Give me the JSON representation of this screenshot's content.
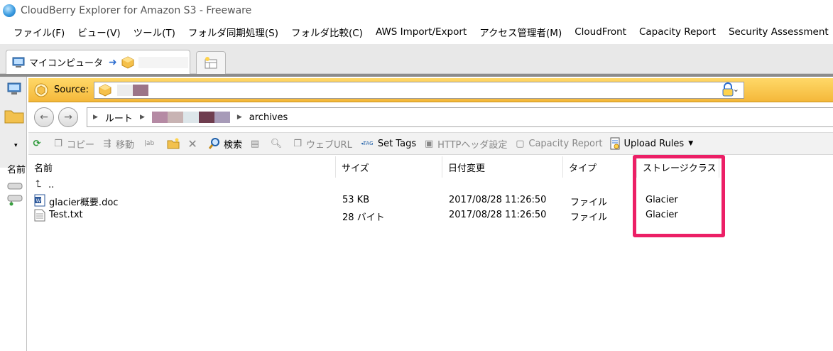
{
  "window": {
    "title": "CloudBerry Explorer for Amazon S3 - Freeware"
  },
  "menu": [
    "ファイル(F)",
    "ビュー(V)",
    "ツール(T)",
    "フォルダ同期処理(S)",
    "フォルダ比較(C)",
    "AWS Import/Export",
    "アクセス管理者(M)",
    "CloudFront",
    "Capacity Report",
    "Security Assessment"
  ],
  "tabs": {
    "active_label": "マイコンピュータ",
    "arrow": "➜"
  },
  "source": {
    "label": "Source:"
  },
  "breadcrumb": {
    "root": "ルート",
    "last": "archives"
  },
  "toolbar": {
    "copy": "コピー",
    "move": "移動",
    "search": "検索",
    "web_url": "ウェブURL",
    "set_tags": "Set Tags",
    "http_headers": "HTTPヘッダ設定",
    "capacity_report": "Capacity Report",
    "upload_rules": "Upload Rules"
  },
  "left_pane": {
    "header": "名前"
  },
  "file_list": {
    "columns": {
      "name": "名前",
      "size": "サイズ",
      "modified": "日付変更",
      "type": "タイプ",
      "storage_class": "ストレージクラス"
    },
    "parent": "..",
    "rows": [
      {
        "name": "glacier概要.doc",
        "size": "53 KB",
        "modified": "2017/08/28 11:26:50",
        "type": "ファイル",
        "storage_class": "Glacier"
      },
      {
        "name": "Test.txt",
        "size": "28 バイト",
        "modified": "2017/08/28 11:26:50",
        "type": "ファイル",
        "storage_class": "Glacier"
      }
    ]
  },
  "colors": {
    "highlight": "#ec1f66",
    "source_bar": "#f4b83a",
    "link_blue": "#2f6fd0"
  }
}
